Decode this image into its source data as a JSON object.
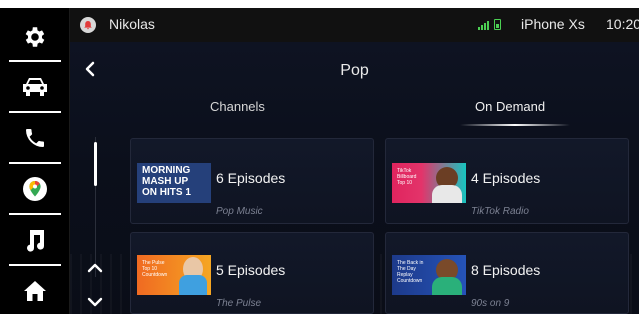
{
  "status_bar": {
    "name": "Nikolas",
    "device": "iPhone Xs",
    "time": "10:20"
  },
  "dock": {
    "items": [
      {
        "icon": "gear-icon",
        "label": "settings"
      },
      {
        "icon": "car-icon",
        "label": "vehicle"
      },
      {
        "icon": "phone-icon",
        "label": "phone"
      },
      {
        "icon": "maps-icon",
        "label": "maps"
      },
      {
        "icon": "music-note-icon",
        "label": "music"
      },
      {
        "icon": "home-icon",
        "label": "home"
      }
    ]
  },
  "header": {
    "title": "Pop"
  },
  "tabs": [
    {
      "label": "Channels",
      "selected": false
    },
    {
      "label": "On Demand",
      "selected": true
    }
  ],
  "cards": [
    {
      "title": "6 Episodes",
      "subtitle": "Pop Music",
      "art_text": [
        "MORNING",
        "MASH UP",
        "ON HITS 1"
      ]
    },
    {
      "title": "4 Episodes",
      "subtitle": "TikTok Radio",
      "art_text": [
        "TikTok Billboard",
        "Top 10"
      ]
    },
    {
      "title": "5 Episodes",
      "subtitle": "The Pulse",
      "art_text": [
        "The Pulse Top 10",
        "Countdown"
      ]
    },
    {
      "title": "8 Episodes",
      "subtitle": "90s on 9",
      "art_text": [
        "The Back in",
        "The Day Replay",
        "Countdown"
      ]
    }
  ],
  "colors": {
    "accent_green": "#4ccf53",
    "background": "#000000",
    "content_bg": "#0e1322"
  }
}
